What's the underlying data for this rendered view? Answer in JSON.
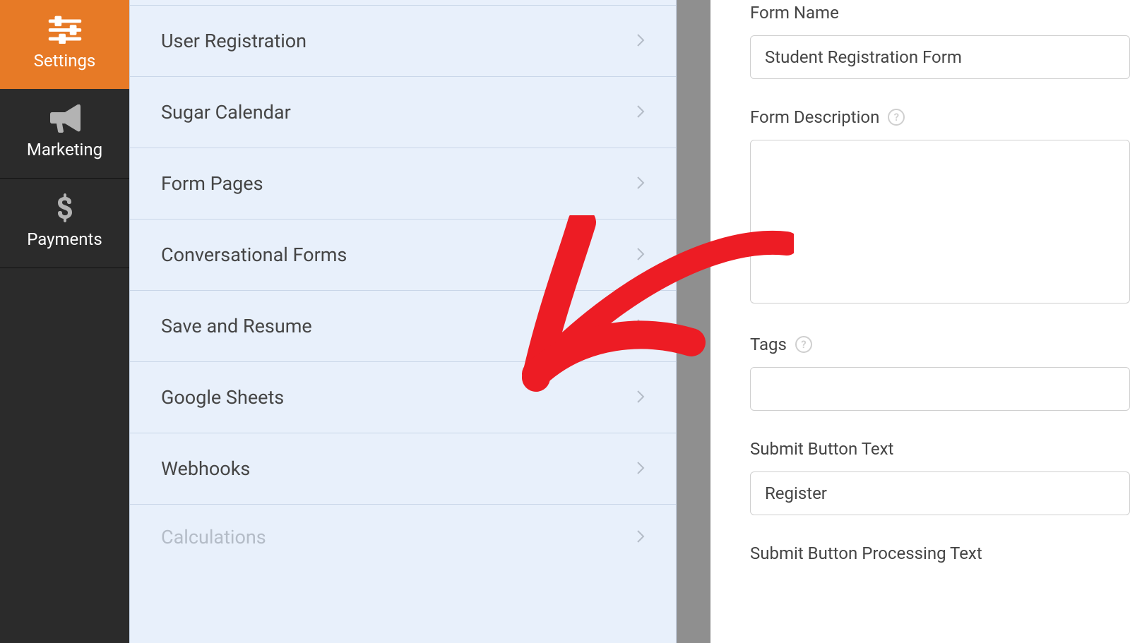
{
  "nav": {
    "settings": "Settings",
    "marketing": "Marketing",
    "payments": "Payments"
  },
  "settings_list": {
    "user_registration": "User Registration",
    "sugar_calendar": "Sugar Calendar",
    "form_pages": "Form Pages",
    "conversational_forms": "Conversational Forms",
    "save_and_resume": "Save and Resume",
    "google_sheets": "Google Sheets",
    "webhooks": "Webhooks",
    "calculations": "Calculations"
  },
  "form": {
    "name_label": "Form Name",
    "name_value": "Student Registration Form",
    "desc_label": "Form Description",
    "desc_value": "",
    "tags_label": "Tags",
    "tags_value": "",
    "submit_label": "Submit Button Text",
    "submit_value": "Register",
    "submit_processing_label": "Submit Button Processing Text"
  }
}
